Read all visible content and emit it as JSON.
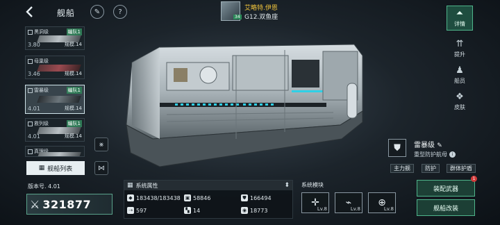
{
  "header": {
    "title": "舰船"
  },
  "commander": {
    "name": "艾略特.伊恩",
    "subtitle": "G12.双鱼座",
    "badge": "34"
  },
  "ship_list": [
    {
      "name": "黑洞级",
      "fleet": "编队1",
      "version": "3.80",
      "scale": "规模.14",
      "selected": false
    },
    {
      "name": "母巢级",
      "fleet": "",
      "version": "3.46",
      "scale": "规模.14",
      "selected": false
    },
    {
      "name": "雷暴级",
      "fleet": "编队1",
      "version": "4.01",
      "scale": "规模.14",
      "selected": true
    },
    {
      "name": "救列级",
      "fleet": "编队1",
      "version": "4.01",
      "scale": "规模.14",
      "selected": false
    },
    {
      "name": "真理级",
      "fleet": "",
      "version": "",
      "scale": "",
      "selected": false
    }
  ],
  "fleet_list_button": "舰船列表",
  "tabs": [
    {
      "label": "详情",
      "active": true
    },
    {
      "label": "提升",
      "active": false
    },
    {
      "label": "船员",
      "active": false
    },
    {
      "label": "皮肤",
      "active": false
    }
  ],
  "ship": {
    "name": "雷暴级",
    "type": "重型防护航母",
    "tags": [
      "主力舰",
      "防护",
      "群体护盾"
    ]
  },
  "version_label": "版本号. 4.01",
  "power": "321877",
  "attributes": {
    "title": "系统属性",
    "items": [
      "183438/183438",
      "58846",
      "166494",
      "597",
      "14",
      "18773"
    ]
  },
  "modules": {
    "title": "系统模块",
    "items": [
      {
        "level": "Lv.8",
        "icon": "crosshair-icon"
      },
      {
        "level": "Lv.8",
        "icon": "signal-icon"
      },
      {
        "level": "Lv.8",
        "icon": "target-icon"
      }
    ]
  },
  "actions": {
    "equip": "装配武器",
    "refit": "舰船改装",
    "notice": "1"
  },
  "colors": {
    "accent": "#4fb58b",
    "gold": "#f0c43c",
    "fleet_badge": "#2f7a56"
  }
}
